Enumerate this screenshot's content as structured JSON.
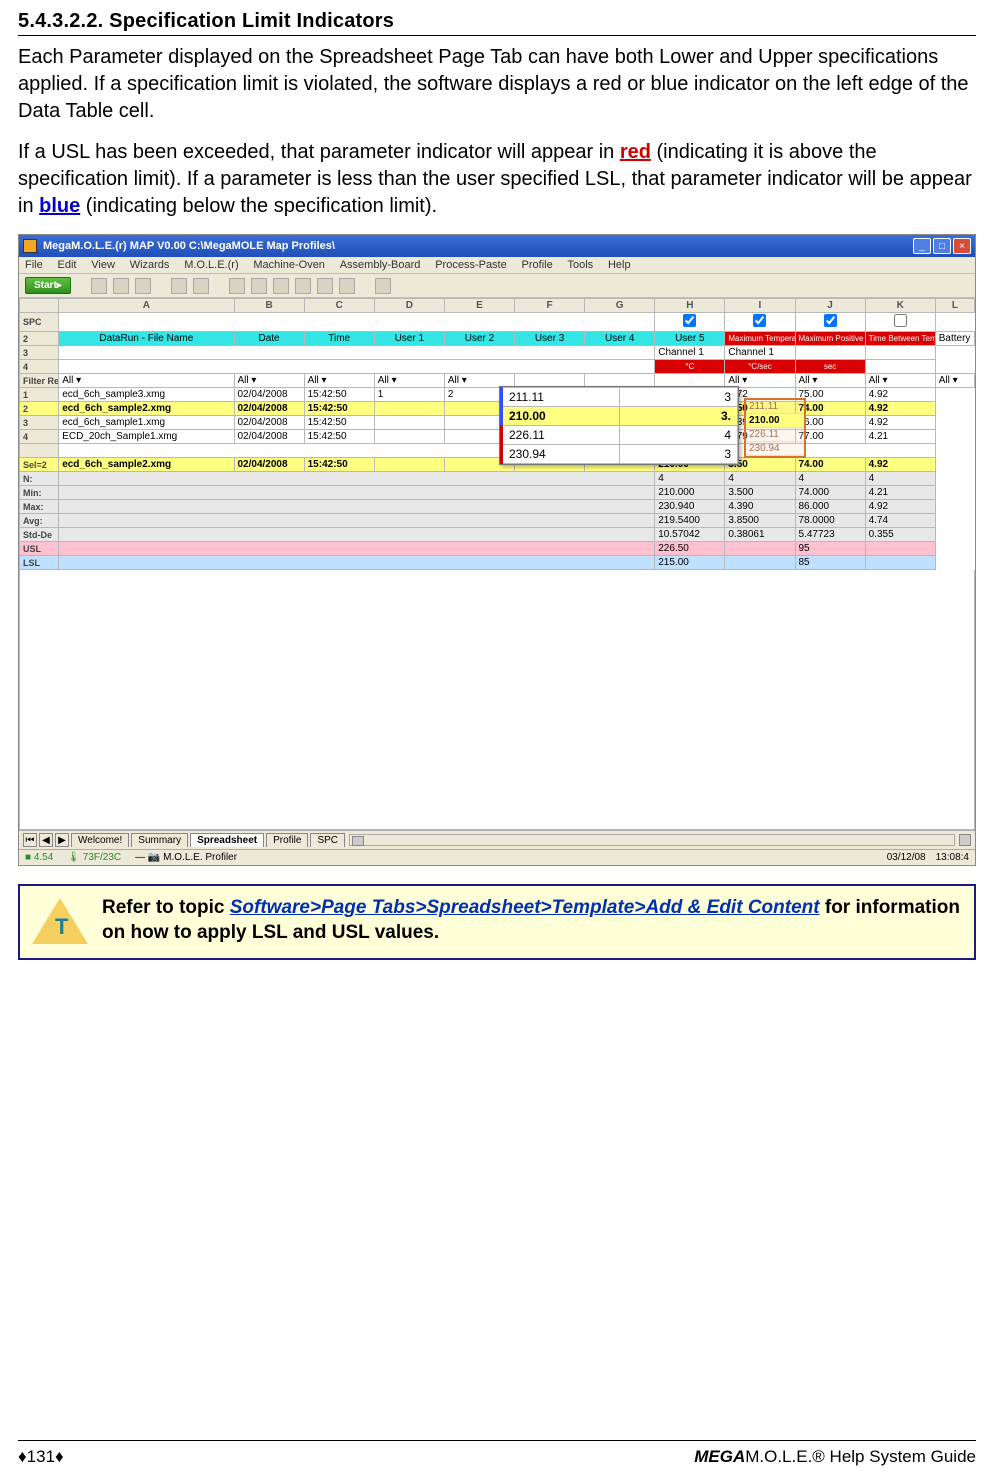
{
  "doc": {
    "section_num": "5.4.3.2.2.",
    "section_title": "Specification Limit Indicators",
    "para1": "Each Parameter displayed on the Spreadsheet Page Tab can have both Lower and Upper specifications applied. If a specification limit is violated, the software displays a red or blue indicator on the left edge of the Data Table cell.",
    "para2_a": "If a USL has been exceeded, that parameter indicator will appear in ",
    "para2_red": "red",
    "para2_b": " (indicating it is above the specification limit). If a parameter is less than the user specified LSL, that parameter indicator will be appear in ",
    "para2_blue": "blue",
    "para2_c": " (indicating below the specification limit).",
    "tip_a": "Refer to topic ",
    "tip_link": "Software>Page Tabs>Spreadsheet>Template>Add & Edit Content",
    "tip_b": " for information on how to apply LSL and USL values.",
    "page_num": "♦131♦",
    "guide_mega": "MEGA",
    "guide_rest": "M.O.L.E.® Help System Guide"
  },
  "app": {
    "title": "MegaM.O.L.E.(r) MAP V0.00    C:\\MegaMOLE Map Profiles\\",
    "menus": [
      "File",
      "Edit",
      "View",
      "Wizards",
      "M.O.L.E.(r)",
      "Machine-Oven",
      "Assembly-Board",
      "Process-Paste",
      "Profile",
      "Tools",
      "Help"
    ],
    "start": "Start",
    "colheads": [
      "A",
      "B",
      "C",
      "D",
      "E",
      "F",
      "G",
      "H",
      "I",
      "J",
      "K",
      "L"
    ],
    "row1": {
      "spc": "SPC"
    },
    "row2": {
      "datarun": "DataRun - File Name",
      "date": "Date",
      "time": "Time",
      "u1": "User 1",
      "u2": "User 2",
      "u3": "User 3",
      "u4": "User 4",
      "u5": "User 5",
      "r1": "Maximum Temperature",
      "r2": "Maximum Positive Slope",
      "r3": "Time Between Temperature",
      "bat": "Battery"
    },
    "row3": {
      "c1": "Channel 1",
      "c2": "Channel 1"
    },
    "row4": {
      "a": "°C",
      "b": "°C/sec",
      "c": "sec"
    },
    "filter": {
      "lbl": "Filter Reset",
      "all": "All"
    },
    "datarows": [
      {
        "n": "1",
        "file": "ecd_6ch_sample3.xmg",
        "date": "02/04/2008",
        "time": "15:42:50",
        "u1": "1",
        "u2": "2",
        "u3": "3",
        "i": "211.11",
        "j": "3.72",
        "k": "75.00",
        "l": "4.92"
      },
      {
        "n": "2",
        "file": "ecd_6ch_sample2.xmg",
        "date": "02/04/2008",
        "time": "15:42:50",
        "u1": "",
        "u2": "",
        "u3": "",
        "i": "210.00",
        "j": "3.50",
        "k": "74.00",
        "l": "4.92"
      },
      {
        "n": "3",
        "file": "ecd_6ch_sample1.xmg",
        "date": "02/04/2008",
        "time": "15:42:50",
        "u1": "",
        "u2": "",
        "u3": "",
        "i": "226.11",
        "j": "4.39",
        "k": "86.00",
        "l": "4.92"
      },
      {
        "n": "4",
        "file": "ECD_20ch_Sample1.xmg",
        "date": "02/04/2008",
        "time": "15:42:50",
        "u1": "",
        "u2": "",
        "u3": "",
        "i": "230.94",
        "j": "3.79",
        "k": "77.00",
        "l": "4.21"
      }
    ],
    "selrow": {
      "lbl": "Sel=2",
      "file": "ecd_6ch_sample2.xmg",
      "date": "02/04/2008",
      "time": "15:42:50",
      "i": "210.00",
      "j": "3.50",
      "k": "74.00",
      "l": "4.92"
    },
    "stats": {
      "N": {
        "lbl": "N:",
        "i": "4",
        "j": "4",
        "k": "4",
        "l": "4"
      },
      "Min": {
        "lbl": "Min:",
        "i": "210.000",
        "j": "3.500",
        "k": "74.000",
        "l": "4.21"
      },
      "Max": {
        "lbl": "Max:",
        "i": "230.940",
        "j": "4.390",
        "k": "86.000",
        "l": "4.92"
      },
      "Avg": {
        "lbl": "Avg:",
        "i": "219.5400",
        "j": "3.8500",
        "k": "78.0000",
        "l": "4.74"
      },
      "Std": {
        "lbl": "Std-De",
        "i": "10.57042",
        "j": "0.38061",
        "k": "5.47723",
        "l": "0.355"
      }
    },
    "usl": {
      "lbl": "USL",
      "i": "226.50",
      "k": "95"
    },
    "lsl": {
      "lbl": "LSL",
      "i": "215.00",
      "k": "85"
    },
    "popup": [
      {
        "v": "211.11",
        "n": "3",
        "cls": "p-blue"
      },
      {
        "v": "210.00",
        "n": "3.",
        "cls": "p-sel p-blue"
      },
      {
        "v": "226.11",
        "n": "4",
        "cls": "p-red"
      },
      {
        "v": "230.94",
        "n": "3",
        "cls": "p-red"
      }
    ],
    "popup_right": [
      "211.11",
      "210.00",
      "226.11",
      "230.94"
    ],
    "tabs": [
      "Welcome!",
      "Summary",
      "Spreadsheet",
      "Profile",
      "SPC"
    ],
    "status": {
      "v1": "4.54",
      "v2": "73F/23C",
      "v3": "M.O.L.E. Profiler",
      "date": "03/12/08",
      "time": "13:08:4"
    }
  }
}
